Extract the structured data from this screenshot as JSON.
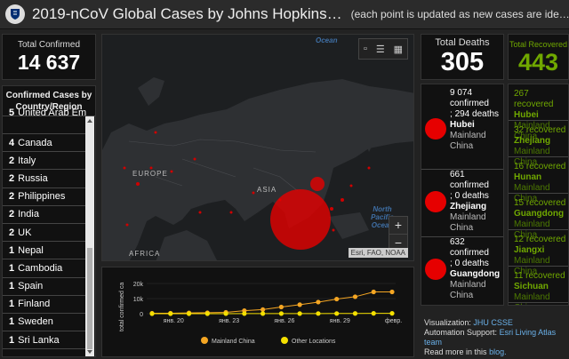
{
  "header": {
    "title": "2019-nCoV Global Cases by Johns Hopkins…",
    "subtitle": "(each point is updated as new cases are ide…"
  },
  "total_confirmed": {
    "label": "Total Confirmed",
    "value": "14 637"
  },
  "country_list": {
    "header": "Confirmed Cases by Country/Region",
    "rows": [
      {
        "count": "5",
        "name": "United Arab Emirates"
      },
      {
        "count": "4",
        "name": "Canada"
      },
      {
        "count": "2",
        "name": "Italy"
      },
      {
        "count": "2",
        "name": "Russia"
      },
      {
        "count": "2",
        "name": "Philippines"
      },
      {
        "count": "2",
        "name": "India"
      },
      {
        "count": "2",
        "name": "UK"
      },
      {
        "count": "1",
        "name": "Nepal"
      },
      {
        "count": "1",
        "name": "Cambodia"
      },
      {
        "count": "1",
        "name": "Spain"
      },
      {
        "count": "1",
        "name": "Finland"
      },
      {
        "count": "1",
        "name": "Sweden"
      },
      {
        "count": "1",
        "name": "Sri Lanka"
      }
    ]
  },
  "map": {
    "labels": {
      "europe": "EUROPE",
      "asia": "ASIA",
      "africa": "AFRICA"
    },
    "ocean_top": "Ocean",
    "ocean_pacific": "North Pacific Ocean",
    "attribution": "Esri, FAO, NOAA",
    "zoom_in": "+",
    "zoom_out": "−",
    "tool_icons": [
      "bookmark-icon",
      "list-icon",
      "grid-icon"
    ]
  },
  "chart_data": {
    "type": "line",
    "x": [
      "янв. 20",
      "янв. 23",
      "янв. 26",
      "янв. 29",
      "февр."
    ],
    "ylabel": "total confirmed ca",
    "yticks": [
      "20k",
      "10k",
      "0"
    ],
    "ylim": [
      0,
      20000
    ],
    "series": [
      {
        "name": "Mainland China",
        "color": "#f5a623",
        "values": [
          278,
          326,
          547,
          639,
          916,
          2000,
          2700,
          4400,
          5970,
          7678,
          9658,
          11221,
          14411,
          14411
        ]
      },
      {
        "name": "Other Locations",
        "color": "#f5e000",
        "values": [
          4,
          6,
          8,
          14,
          25,
          40,
          57,
          64,
          87,
          105,
          118,
          153,
          226,
          226
        ]
      }
    ]
  },
  "total_deaths": {
    "label": "Total Deaths",
    "value": "305"
  },
  "deaths_list": [
    {
      "confirmed": "9 074",
      "confirmed_label": "confirmed",
      "deaths": "294 deaths",
      "province": "Hubei",
      "country": "Mainland China"
    },
    {
      "confirmed": "661",
      "confirmed_label": "confirmed",
      "deaths": "0 deaths",
      "province": "Zhejiang",
      "country": "Mainland China"
    },
    {
      "confirmed": "632",
      "confirmed_label": "confirmed",
      "deaths": "0 deaths",
      "province": "Guangdong",
      "country": "Mainland China"
    }
  ],
  "total_recovered": {
    "label": "Total Recovered",
    "value": "443"
  },
  "recovered_list": [
    {
      "count": "267 recovered",
      "province": "Hubei",
      "country": "Mainland China"
    },
    {
      "count": "32 recovered",
      "province": "Zhejiang",
      "country": "Mainland China"
    },
    {
      "count": "16 recovered",
      "province": "Hunan",
      "country": "Mainland China"
    },
    {
      "count": "15 recovered",
      "province": "Guangdong",
      "country": "Mainland China"
    },
    {
      "count": "12 recovered",
      "province": "Jiangxi",
      "country": "Mainland China"
    },
    {
      "count": "11 recovered",
      "province": "Sichuan",
      "country": "Mainland China"
    }
  ],
  "info": {
    "visualization_label": "Visualization:",
    "visualization_link": "JHU CSSE",
    "automation_label": "Automation Support:",
    "automation_link": "Esri Living Atlas team",
    "read_more": "Read more in this",
    "blog_link": "blog."
  }
}
